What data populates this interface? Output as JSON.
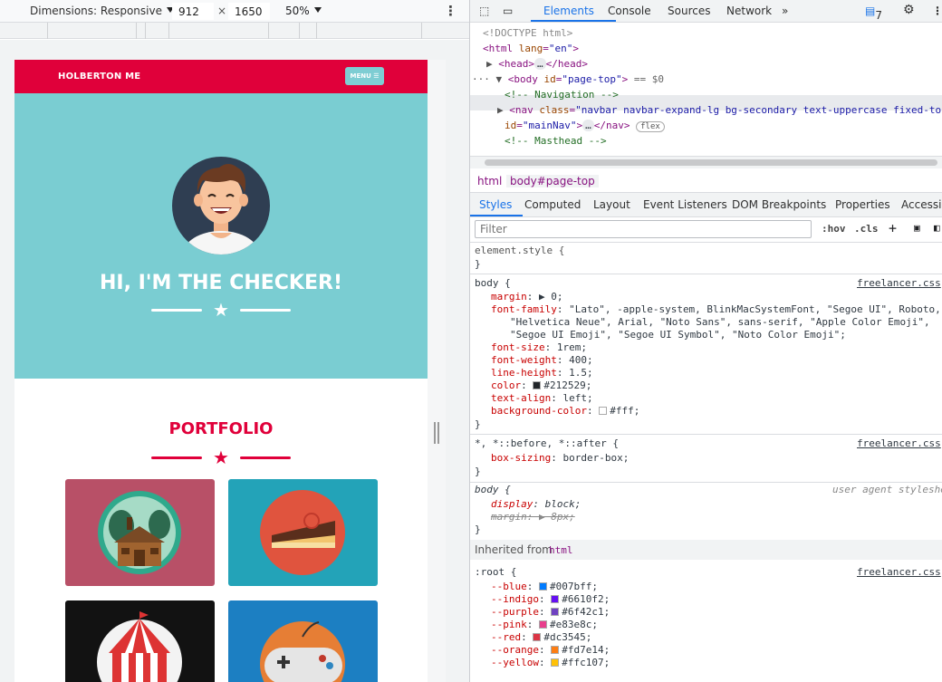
{
  "device_toolbar": {
    "dimensions_label": "Dimensions: Responsive",
    "width": "912",
    "times": "×",
    "height": "1650",
    "zoom": "50%"
  },
  "page": {
    "brand": "HOLBERTON ME",
    "menu_label": "MENU ☰",
    "hero_title": "HI, I'M THE CHECKER!",
    "portfolio_title": "PORTFOLIO",
    "colors": {
      "nav": "#e0003a",
      "masthead": "#7acdd2",
      "accent": "#e0003a"
    },
    "portfolio_tiles": [
      {
        "name": "cabin",
        "bg": "#b85067"
      },
      {
        "name": "cake",
        "bg": "#23a3b8"
      },
      {
        "name": "circus",
        "bg": "#121212"
      },
      {
        "name": "game",
        "bg": "#1c7fc2"
      }
    ]
  },
  "devtools": {
    "tabs": [
      "Elements",
      "Console",
      "Sources",
      "Network"
    ],
    "more_tabs": "»",
    "issues_count": "7",
    "dom": {
      "doctype": "<!DOCTYPE html>",
      "html_open": "<html",
      "html_attr": "lang",
      "html_val": "\"en\"",
      "head": "<head>",
      "head_close": "</head>",
      "ellipsis": "…",
      "body_tag": "<body",
      "body_attr": "id",
      "body_val": "\"page-top\"",
      "body_eq": "== $0",
      "comment_nav": "<!-- Navigation -->",
      "nav_tag": "<nav",
      "nav_class_attr": "class",
      "nav_class_val": "\"navbar navbar-expand-lg bg-secondary text-uppercase fixed-top",
      "nav_id_attr": "id",
      "nav_id_val": "\"mainNav\"",
      "nav_close": "</nav>",
      "flex_badge": "flex",
      "comment_masthead": "<!-- Masthead -->"
    },
    "breadcrumbs": [
      "html",
      "body#page-top"
    ],
    "subtabs": [
      "Styles",
      "Computed",
      "Layout",
      "Event Listeners",
      "DOM Breakpoints",
      "Properties",
      "Accessib"
    ],
    "filter_placeholder": "Filter",
    "hov": ":hov",
    "cls": ".cls",
    "rules": {
      "element_style": "element.style {",
      "close": "}",
      "body_sel": "body {",
      "source": "freelancer.css",
      "margin_prop": "margin",
      "margin_val": "▶ 0;",
      "font_family_prop": "font-family",
      "font_family_val1": "\"Lato\", -apple-system, BlinkMacSystemFont, \"Segoe UI\", Roboto,",
      "font_family_val2": "\"Helvetica Neue\", Arial, \"Noto Sans\", sans-serif, \"Apple Color Emoji\",",
      "font_family_val3": "\"Segoe UI Emoji\", \"Segoe UI Symbol\", \"Noto Color Emoji\";",
      "font_size_prop": "font-size",
      "font_size_val": "1rem;",
      "font_weight_prop": "font-weight",
      "font_weight_val": "400;",
      "line_height_prop": "line-height",
      "line_height_val": "1.5;",
      "color_prop": "color",
      "color_val": "#212529;",
      "text_align_prop": "text-align",
      "text_align_val": "left;",
      "bg_prop": "background-color",
      "bg_val": "#fff;",
      "universal_sel": "*, *::before, *::after {",
      "box_sizing_prop": "box-sizing",
      "box_sizing_val": "border-box;",
      "ua_body_sel": "body {",
      "ua_source": "user agent styleshe",
      "display_prop": "display",
      "display_val": "block;",
      "ua_margin_prop": "margin",
      "ua_margin_val": "▶ 8px;",
      "inherited_label": "Inherited from",
      "inherited_from": "html",
      "root_sel": ":root {",
      "vars": [
        {
          "name": "--blue",
          "value": "#007bff;",
          "color": "#007bff"
        },
        {
          "name": "--indigo",
          "value": "#6610f2;",
          "color": "#6610f2"
        },
        {
          "name": "--purple",
          "value": "#6f42c1;",
          "color": "#6f42c1"
        },
        {
          "name": "--pink",
          "value": "#e83e8c;",
          "color": "#e83e8c"
        },
        {
          "name": "--red",
          "value": "#dc3545;",
          "color": "#dc3545"
        },
        {
          "name": "--orange",
          "value": "#fd7e14;",
          "color": "#fd7e14"
        },
        {
          "name": "--yellow",
          "value": "#ffc107;",
          "color": "#ffc107"
        }
      ]
    }
  }
}
